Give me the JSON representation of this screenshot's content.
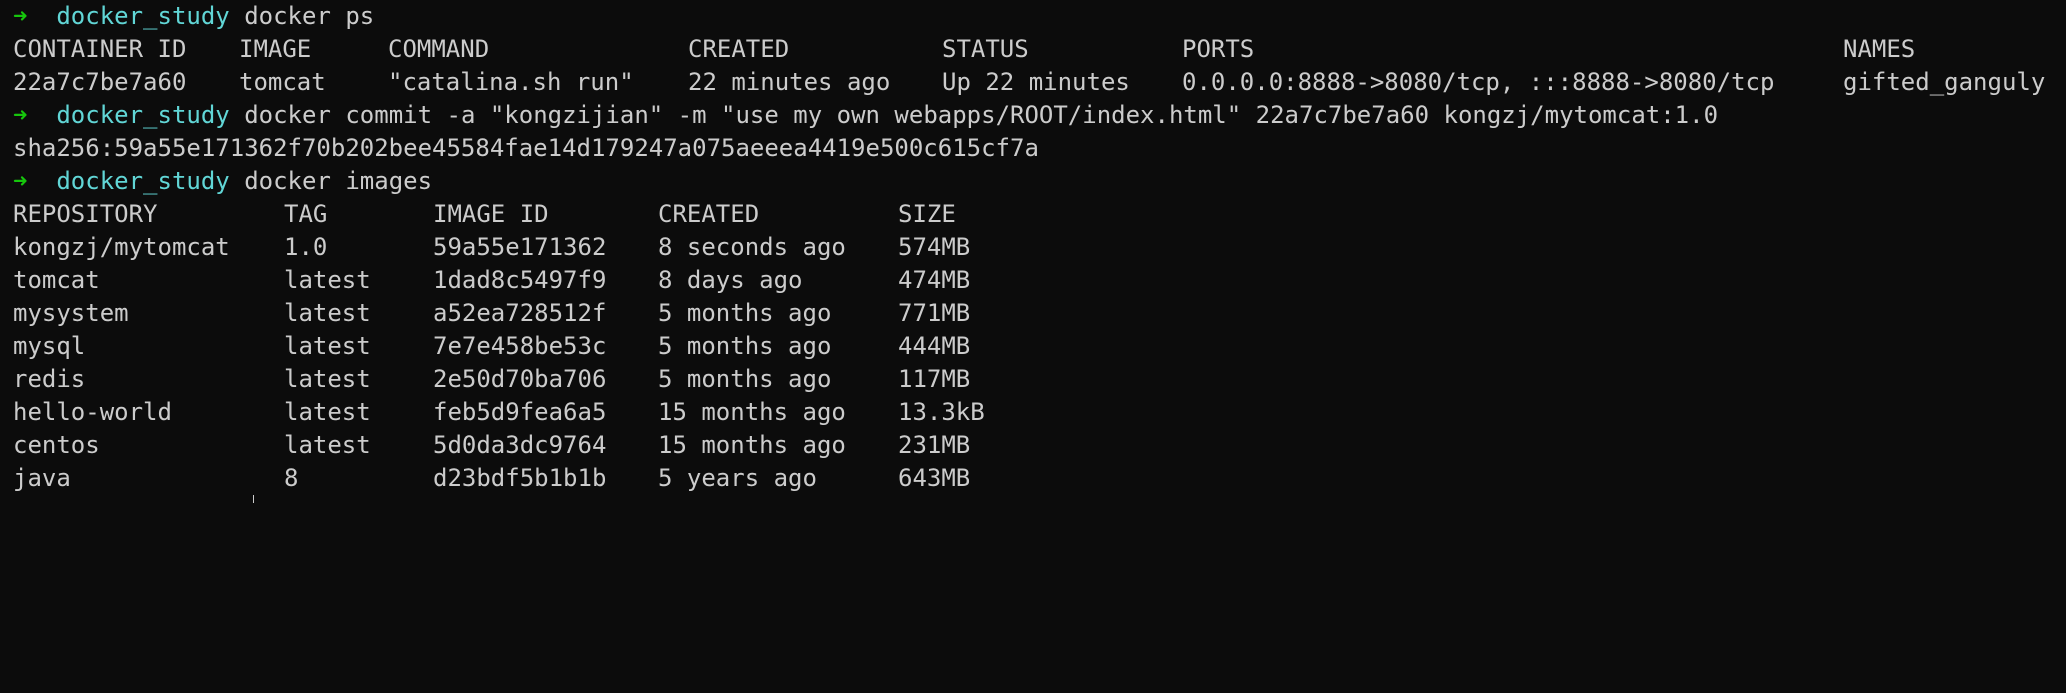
{
  "prompt": {
    "arrow": "➜",
    "dir": "docker_study"
  },
  "commands": {
    "ps": "docker ps",
    "commit": "docker commit -a \"kongzijian\" -m \"use my own webapps/ROOT/index.html\" 22a7c7be7a60 kongzj/mytomcat:1.0",
    "images": "docker images"
  },
  "ps_table": {
    "headers": [
      "CONTAINER ID",
      "IMAGE",
      "COMMAND",
      "CREATED",
      "STATUS",
      "PORTS",
      "NAMES"
    ],
    "rows": [
      [
        "22a7c7be7a60",
        "tomcat",
        "\"catalina.sh run\"",
        "22 minutes ago",
        "Up 22 minutes",
        "0.0.0.0:8888->8080/tcp, :::8888->8080/tcp",
        "gifted_ganguly"
      ]
    ]
  },
  "commit_output": "sha256:59a55e171362f70b202bee45584fae14d179247a075aeeea4419e500c615cf7a",
  "images_table": {
    "headers": [
      "REPOSITORY",
      "TAG",
      "IMAGE ID",
      "CREATED",
      "SIZE"
    ],
    "rows": [
      [
        "kongzj/mytomcat",
        "1.0",
        "59a55e171362",
        "8 seconds ago",
        "574MB"
      ],
      [
        "tomcat",
        "latest",
        "1dad8c5497f9",
        "8 days ago",
        "474MB"
      ],
      [
        "mysystem",
        "latest",
        "a52ea728512f",
        "5 months ago",
        "771MB"
      ],
      [
        "mysql",
        "latest",
        "7e7e458be53c",
        "5 months ago",
        "444MB"
      ],
      [
        "redis",
        "latest",
        "2e50d70ba706",
        "5 months ago",
        "117MB"
      ],
      [
        "hello-world",
        "latest",
        "feb5d9fea6a5",
        "15 months ago",
        "13.3kB"
      ],
      [
        "centos",
        "latest",
        "5d0da3dc9764",
        "15 months ago",
        "231MB"
      ],
      [
        "java",
        "8",
        "d23bdf5b1b1b",
        "5 years ago",
        "643MB"
      ]
    ]
  },
  "colors": {
    "background": "#0c0c0c",
    "text": "#cccccc",
    "prompt_arrow": "#16c60c",
    "prompt_dir": "#61d6d6"
  }
}
